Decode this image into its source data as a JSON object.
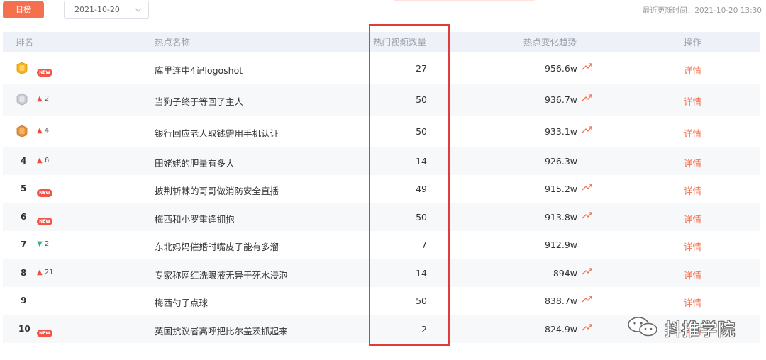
{
  "toolbar": {
    "tab_label": "日榜",
    "date_value": "2021-10-20",
    "update_label": "最近更新时间：2021-10-20 13:30"
  },
  "columns": {
    "rank": "排名",
    "topic": "热点名称",
    "video_count": "热门视频数量",
    "trend": "热点变化趋势",
    "action": "操作"
  },
  "rows": [
    {
      "rank": "1",
      "medal": "gold",
      "change_dir": "new",
      "change": "NEW",
      "topic": "库里连中4记logoshot",
      "video_count": "27",
      "heat": "956.6w",
      "trend_up": true,
      "action": "详情"
    },
    {
      "rank": "2",
      "medal": "silver",
      "change_dir": "up",
      "change": "2",
      "topic": "当狗子终于等回了主人",
      "video_count": "50",
      "heat": "936.7w",
      "trend_up": true,
      "action": "详情"
    },
    {
      "rank": "3",
      "medal": "bronze",
      "change_dir": "up",
      "change": "4",
      "topic": "银行回应老人取钱需用手机认证",
      "video_count": "50",
      "heat": "933.1w",
      "trend_up": true,
      "action": "详情"
    },
    {
      "rank": "4",
      "medal": "",
      "change_dir": "up",
      "change": "6",
      "topic": "田姥姥的胆量有多大",
      "video_count": "14",
      "heat": "926.3w",
      "trend_up": false,
      "action": "详情"
    },
    {
      "rank": "5",
      "medal": "",
      "change_dir": "new",
      "change": "NEW",
      "topic": "披荆斩棘的哥哥做消防安全直播",
      "video_count": "49",
      "heat": "915.2w",
      "trend_up": true,
      "action": "详情"
    },
    {
      "rank": "6",
      "medal": "",
      "change_dir": "new",
      "change": "NEW",
      "topic": "梅西和小罗重逢拥抱",
      "video_count": "50",
      "heat": "913.8w",
      "trend_up": true,
      "action": "详情"
    },
    {
      "rank": "7",
      "medal": "",
      "change_dir": "down",
      "change": "2",
      "topic": "东北妈妈催婚时嘴皮子能有多溜",
      "video_count": "7",
      "heat": "912.9w",
      "trend_up": false,
      "action": "详情"
    },
    {
      "rank": "8",
      "medal": "",
      "change_dir": "up",
      "change": "21",
      "topic": "专家称网红洗眼液无异于死水浸泡",
      "video_count": "14",
      "heat": "894w",
      "trend_up": true,
      "action": "详情"
    },
    {
      "rank": "9",
      "medal": "",
      "change_dir": "same",
      "change": "",
      "topic": "梅西勺子点球",
      "video_count": "50",
      "heat": "838.7w",
      "trend_up": true,
      "action": "详情"
    },
    {
      "rank": "10",
      "medal": "",
      "change_dir": "new",
      "change": "NEW",
      "topic": "英国抗议者高呼把比尔盖茨抓起来",
      "video_count": "2",
      "heat": "824.9w",
      "trend_up": true,
      "action": "详情"
    }
  ],
  "watermark": {
    "text": "抖推学院",
    "icon": "wechat-icon"
  },
  "colors": {
    "accent": "#f4704f",
    "up": "#ef4a3b",
    "down": "#31b08f",
    "highlight": "#e23b3b"
  }
}
